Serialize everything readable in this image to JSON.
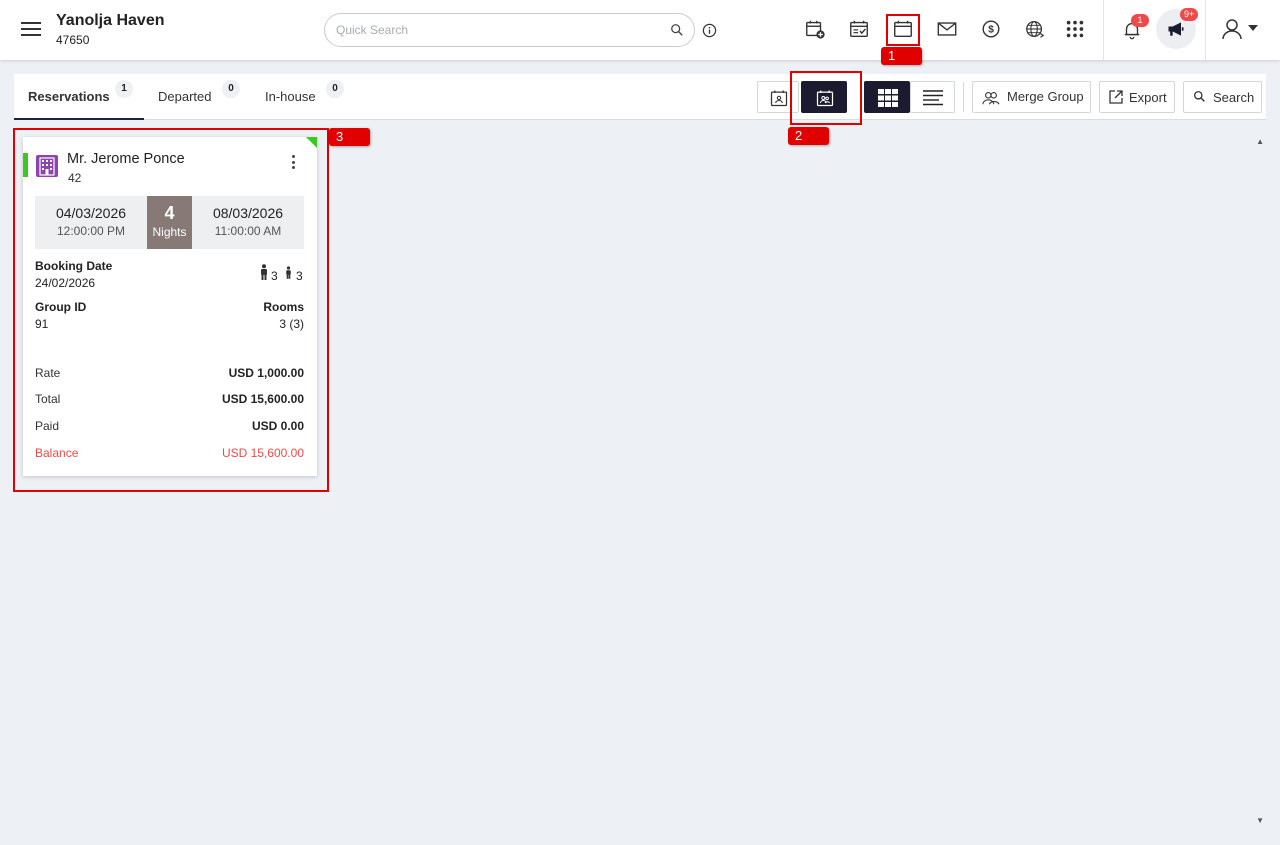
{
  "header": {
    "hotel_name": "Yanolja Haven",
    "hotel_id": "47650",
    "search_placeholder": "Quick Search",
    "notification_count": "1",
    "announcement_count": "9+"
  },
  "tabs": [
    {
      "label": "Reservations",
      "count": "1",
      "active": true
    },
    {
      "label": "Departed",
      "count": "0",
      "active": false
    },
    {
      "label": "In-house",
      "count": "0",
      "active": false
    }
  ],
  "toolbar": {
    "merge_group_label": "Merge Group",
    "export_label": "Export",
    "search_label": "Search"
  },
  "annotations": [
    "1",
    "2",
    "3"
  ],
  "reservation": {
    "guest_name": "Mr. Jerome Ponce",
    "guest_id": "42",
    "arrival_date": "04/03/2026",
    "arrival_time": "12:00:00 PM",
    "nights": "4",
    "nights_label": "Nights",
    "departure_date": "08/03/2026",
    "departure_time": "11:00:00 AM",
    "booking_date_label": "Booking Date",
    "booking_date": "24/02/2026",
    "adults": "3",
    "children": "3",
    "group_id_label": "Group ID",
    "group_id": "91",
    "rooms_label": "Rooms",
    "rooms": "3 (3)",
    "rate_label": "Rate",
    "rate": "USD 1,000.00",
    "total_label": "Total",
    "total": "USD 15,600.00",
    "paid_label": "Paid",
    "paid": "USD 0.00",
    "balance_label": "Balance",
    "balance": "USD 15,600.00",
    "status_color": "#3cc81e"
  },
  "colors": {
    "accent_dark": "#1c1a2e",
    "annotation_red": "#e00000",
    "balance_red": "#ef4a4a",
    "nights_bg": "#877a76",
    "building_purple": "#8e44ad"
  },
  "icons": [
    "menu-icon",
    "search-icon",
    "info-icon",
    "calendar-add-icon",
    "calendar-check-icon",
    "calendar-icon",
    "mail-icon",
    "dollar-icon",
    "globe-icon",
    "apps-grid-icon",
    "bell-icon",
    "megaphone-icon",
    "user-icon",
    "building-icon"
  ]
}
